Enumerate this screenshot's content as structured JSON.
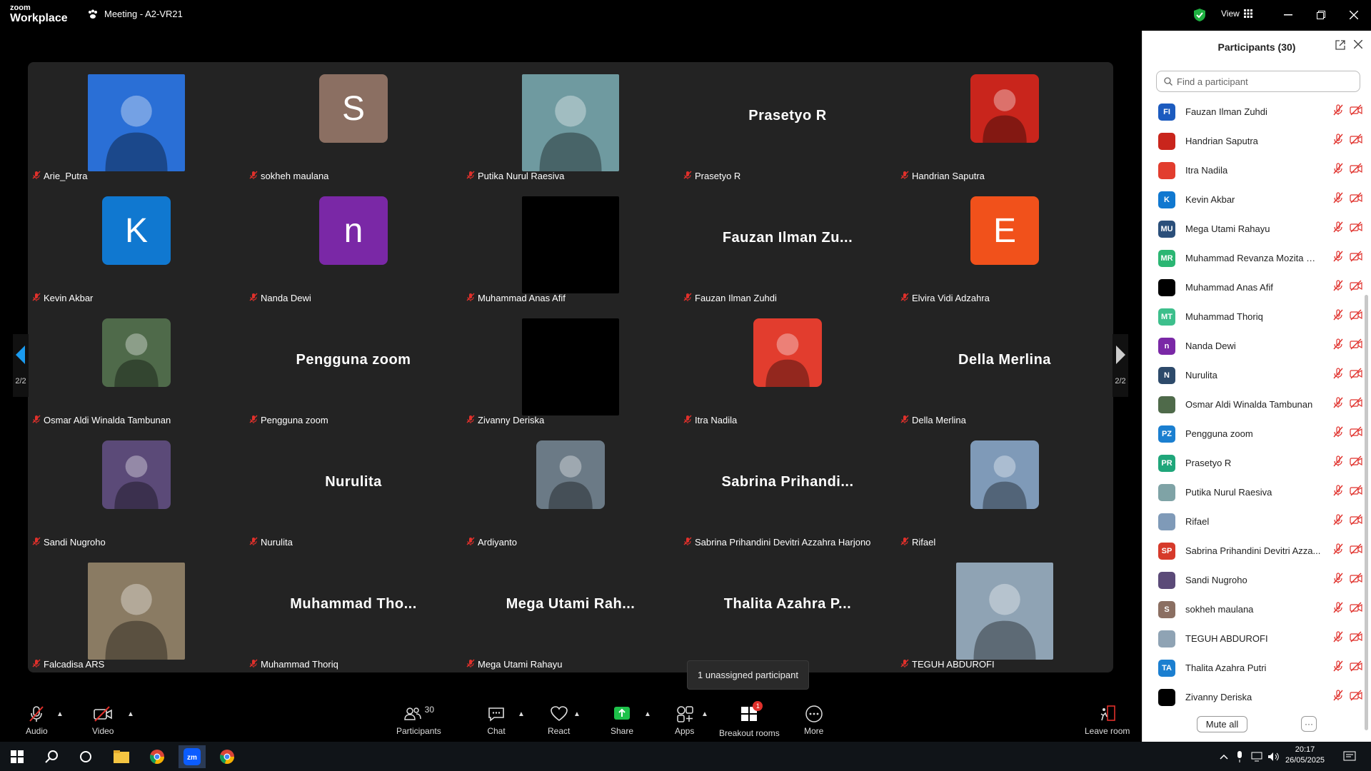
{
  "app": {
    "brand_top": "zoom",
    "brand_bottom": "Workplace",
    "meeting_title": "Meeting - A2-VR21",
    "view_label": "View"
  },
  "grid": {
    "page_indicator": "2/2",
    "tiles": [
      {
        "name": "Arie_Putra",
        "kind": "photo",
        "color": "#2a6fd6"
      },
      {
        "name": "sokheh maulana",
        "kind": "initial",
        "initial": "S",
        "color": "#8b6f62"
      },
      {
        "name": "Putika Nurul Raesiva",
        "kind": "photo",
        "color": "#6f9aa0"
      },
      {
        "name": "Prasetyo R",
        "kind": "text",
        "display": "Prasetyo R"
      },
      {
        "name": "Handrian Saputra",
        "kind": "photo",
        "color": "#c9251c"
      },
      {
        "name": "Kevin Akbar",
        "kind": "initial",
        "initial": "K",
        "color": "#1078d0"
      },
      {
        "name": "Nanda Dewi",
        "kind": "initial",
        "initial": "n",
        "color": "#7a28a6"
      },
      {
        "name": "Muhammad Anas Afif",
        "kind": "photo",
        "color": "#000000"
      },
      {
        "name": "Fauzan Ilman Zuhdi",
        "kind": "text",
        "display": "Fauzan Ilman Zu..."
      },
      {
        "name": "Elvira Vidi Adzahra",
        "kind": "initial",
        "initial": "E",
        "color": "#f1511b"
      },
      {
        "name": "Osmar Aldi Winalda Tambunan",
        "kind": "photo",
        "color": "#4f6a4a"
      },
      {
        "name": "Pengguna zoom",
        "kind": "text",
        "display": "Pengguna zoom"
      },
      {
        "name": "Zivanny Deriska",
        "kind": "photo",
        "color": "#000000"
      },
      {
        "name": "Itra Nadila",
        "kind": "photo",
        "color": "#e23d2e"
      },
      {
        "name": "Della Merlina",
        "kind": "text",
        "display": "Della Merlina"
      },
      {
        "name": "Sandi Nugroho",
        "kind": "photo",
        "color": "#5b4a78"
      },
      {
        "name": "Nurulita",
        "kind": "text",
        "display": "Nurulita"
      },
      {
        "name": "Ardiyanto",
        "kind": "photo",
        "color": "#6b7a86"
      },
      {
        "name": "Sabrina Prihandini Devitri Azzahra Harjono",
        "kind": "text",
        "display": "Sabrina Prihandi..."
      },
      {
        "name": "Rifael",
        "kind": "photo",
        "color": "#7f9ab8"
      },
      {
        "name": "Falcadisa ARS",
        "kind": "photo",
        "color": "#8a7b63"
      },
      {
        "name": "Muhammad Thoriq",
        "kind": "text",
        "display": "Muhammad Tho..."
      },
      {
        "name": "Mega Utami Rahayu",
        "kind": "text",
        "display": "Mega Utami Rah..."
      },
      {
        "name": "",
        "kind": "text",
        "display": "Thalita Azahra P..."
      },
      {
        "name": "TEGUH ABDUROFI",
        "kind": "photo",
        "color": "#8fa3b4"
      }
    ]
  },
  "tooltip": "1 unassigned participant",
  "panel": {
    "title": "Participants (30)",
    "search_placeholder": "Find a participant",
    "participants": [
      {
        "name": "Fauzan Ilman Zuhdi",
        "initials": "FI",
        "color": "#1c5bbf"
      },
      {
        "name": "Handrian Saputra",
        "initials": "",
        "color": "#c9251c"
      },
      {
        "name": "Itra Nadila",
        "initials": "",
        "color": "#e23d2e"
      },
      {
        "name": "Kevin Akbar",
        "initials": "K",
        "color": "#1078d0"
      },
      {
        "name": "Mega Utami Rahayu",
        "initials": "MU",
        "color": "#2b4f7a"
      },
      {
        "name": "Muhammad Revanza Mozita Ha...",
        "initials": "MR",
        "color": "#2bb673"
      },
      {
        "name": "Muhammad Anas Afif",
        "initials": "",
        "color": "#000000"
      },
      {
        "name": "Muhammad Thoriq",
        "initials": "MT",
        "color": "#3dbf8c"
      },
      {
        "name": "Nanda Dewi",
        "initials": "n",
        "color": "#7a28a6"
      },
      {
        "name": "Nurulita",
        "initials": "N",
        "color": "#2d4a6a"
      },
      {
        "name": "Osmar Aldi Winalda Tambunan",
        "initials": "",
        "color": "#4f6a4a"
      },
      {
        "name": "Pengguna zoom",
        "initials": "PZ",
        "color": "#1b7fd0"
      },
      {
        "name": "Prasetyo R",
        "initials": "PR",
        "color": "#1fa67a"
      },
      {
        "name": "Putika Nurul Raesiva",
        "initials": "",
        "color": "#7fa3a6"
      },
      {
        "name": "Rifael",
        "initials": "",
        "color": "#7f9ab8"
      },
      {
        "name": "Sabrina Prihandini Devitri Azza...",
        "initials": "SP",
        "color": "#d63a2b"
      },
      {
        "name": "Sandi Nugroho",
        "initials": "",
        "color": "#5b4a78"
      },
      {
        "name": "sokheh maulana",
        "initials": "S",
        "color": "#8b6f62"
      },
      {
        "name": "TEGUH ABDUROFI",
        "initials": "",
        "color": "#8fa3b4"
      },
      {
        "name": "Thalita Azahra Putri",
        "initials": "TA",
        "color": "#1b7fd0"
      },
      {
        "name": "Zivanny Deriska",
        "initials": "",
        "color": "#000000"
      }
    ],
    "mute_all": "Mute all",
    "more": "···"
  },
  "toolbar": {
    "audio": "Audio",
    "video": "Video",
    "participants": "Participants",
    "participants_count": "30",
    "chat": "Chat",
    "react": "React",
    "share": "Share",
    "apps": "Apps",
    "breakout": "Breakout rooms",
    "breakout_badge": "1",
    "more": "More",
    "leave": "Leave room"
  },
  "taskbar": {
    "time": "20:17",
    "date": "26/05/2025"
  }
}
